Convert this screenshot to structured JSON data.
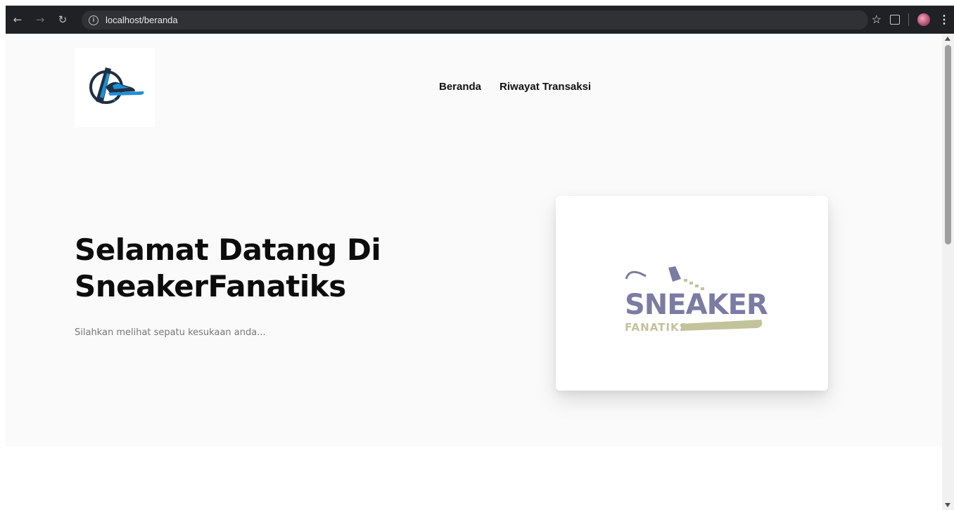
{
  "browser": {
    "url": "localhost/beranda",
    "icons": [
      "back-arrow-icon",
      "forward-arrow-icon",
      "reload-icon",
      "site-info-icon",
      "bookmark-star-icon",
      "extensions-icon",
      "profile-avatar",
      "menu-kebab-icon"
    ]
  },
  "nav": {
    "items": [
      {
        "label": "Beranda"
      },
      {
        "label": "Riwayat Transaksi"
      }
    ]
  },
  "hero": {
    "title_line1": "Selamat Datang Di",
    "title_line2": "SneakerFanatiks",
    "subtitle": "Silahkan melihat sepatu kesukaan anda...",
    "card_logo_text_top": "SNEAKER",
    "card_logo_text_bottom": "FANATIKS"
  },
  "colors": {
    "hero_bg": "#fafafa",
    "logo_purple": "#7b7ba3",
    "logo_olive": "#c2c39a",
    "logo_blue": "#1d8fd8",
    "logo_navy": "#1f2f44"
  }
}
